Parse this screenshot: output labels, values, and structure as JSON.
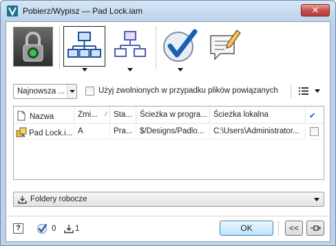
{
  "window": {
    "title": "Pobierz/Wypisz — Pad Lock.iam",
    "close_label": "✕"
  },
  "toolbar": {
    "buttons": [
      {
        "name": "lock-status",
        "icon": "padlock-icon"
      },
      {
        "name": "include-children",
        "icon": "tree-structure-icon",
        "has_dropdown": true,
        "pressed": true
      },
      {
        "name": "include-parents",
        "icon": "tree-structure-alt-icon",
        "has_dropdown": true
      },
      {
        "name": "check-out",
        "icon": "checkmark-circle-icon",
        "has_dropdown": true
      },
      {
        "name": "comment",
        "icon": "comment-pencil-icon"
      }
    ]
  },
  "options": {
    "version_select": "Najnowsza ...",
    "use_released_label": "Użyj zwolnionych w przypadku plików powiązanych",
    "use_released_checked": false
  },
  "grid": {
    "columns": [
      "Nazwa",
      "Zmi...",
      "Sta...",
      "Ścieżka w progra...",
      "Ścieżka lokalna"
    ],
    "check_column_header": "✔",
    "rows": [
      {
        "name": "Pad Lock.i...",
        "change": "A",
        "state": "Pra...",
        "program_path": "$/Designs/Padlo...",
        "local_path": "C:\\Users\\Administrator...",
        "checked": false
      }
    ]
  },
  "folders": {
    "label": "Foldery robocze"
  },
  "status": {
    "help_label": "?",
    "checked_count": "0",
    "download_count": "1",
    "ok_label": "OK",
    "collapse_label": "<<",
    "pin_label": "⊣"
  },
  "colors": {
    "accent": "#1a5fb4",
    "title_bar": "#bcd3ea",
    "close_red": "#c75050"
  }
}
